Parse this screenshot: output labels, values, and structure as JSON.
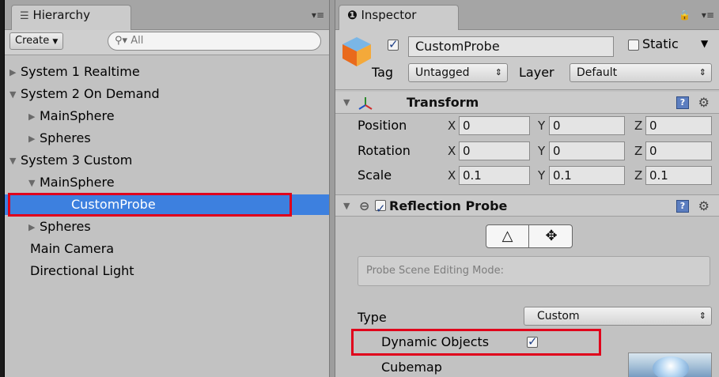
{
  "hierarchy": {
    "tab_label": "Hierarchy",
    "tab_icon": "list-icon",
    "create_label": "Create",
    "search_placeholder": "All",
    "items": [
      {
        "label": "System 1 Realtime",
        "expanded": false
      },
      {
        "label": "System 2 On Demand",
        "expanded": true
      },
      {
        "label": "MainSphere",
        "expanded": false
      },
      {
        "label": "Spheres",
        "expanded": false
      },
      {
        "label": "System 3 Custom",
        "expanded": true
      },
      {
        "label": "MainSphere",
        "expanded": true
      },
      {
        "label": "CustomProbe",
        "selected": true
      },
      {
        "label": "Spheres",
        "expanded": false
      },
      {
        "label": "Main Camera"
      },
      {
        "label": "Directional Light"
      }
    ]
  },
  "inspector": {
    "tab_label": "Inspector",
    "tab_icon": "info-icon",
    "object": {
      "active": true,
      "name": "CustomProbe",
      "static_label": "Static",
      "static": false,
      "tag_label": "Tag",
      "tag_value": "Untagged",
      "layer_label": "Layer",
      "layer_value": "Default"
    },
    "transform": {
      "title": "Transform",
      "rows": [
        {
          "label": "Position",
          "x": "0",
          "y": "0",
          "z": "0"
        },
        {
          "label": "Rotation",
          "x": "0",
          "y": "0",
          "z": "0"
        },
        {
          "label": "Scale",
          "x": "0.1",
          "y": "0.1",
          "z": "0.1"
        }
      ],
      "axis_x": "X",
      "axis_y": "Y",
      "axis_z": "Z"
    },
    "reflection_probe": {
      "title": "Reflection Probe",
      "enabled": true,
      "scene_editing_mode": "Probe Scene Editing Mode:",
      "type_label": "Type",
      "type_value": "Custom",
      "dynamic_objects_label": "Dynamic Objects",
      "dynamic_objects": true,
      "cubemap_label": "Cubemap"
    }
  },
  "colors": {
    "selection": "#3d80df",
    "highlight_box": "#e0001b",
    "panel_bg": "#c2c2c2"
  }
}
